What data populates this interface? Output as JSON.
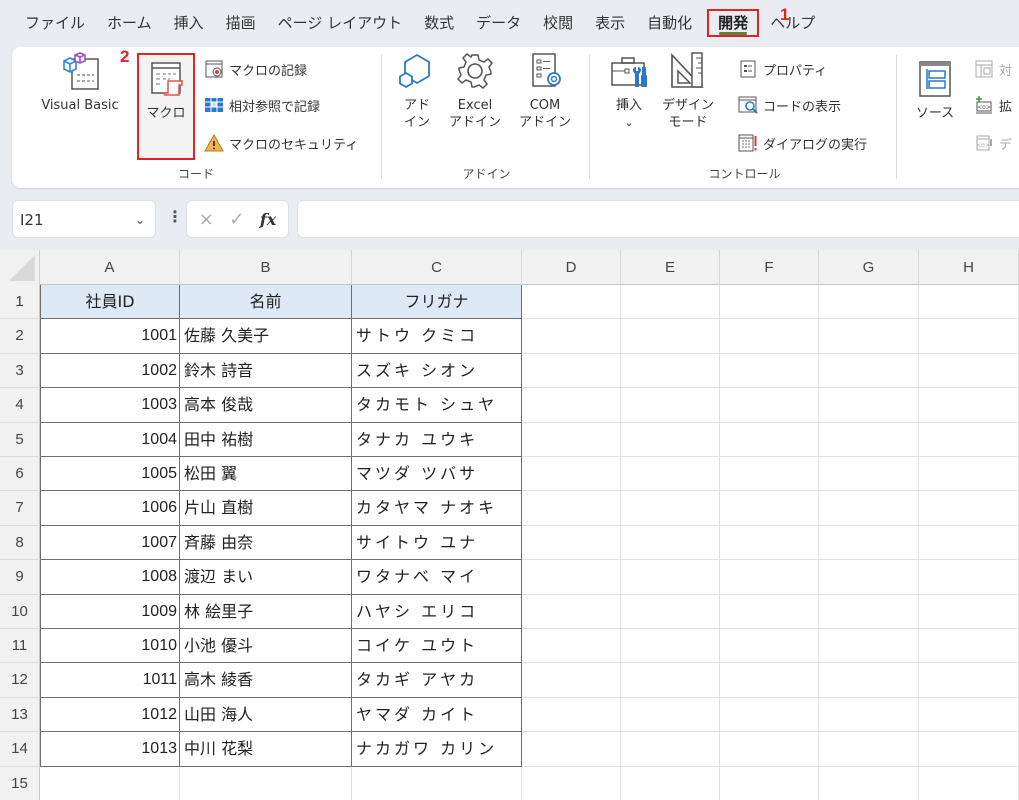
{
  "menu": {
    "tabs": [
      {
        "label": "ファイル"
      },
      {
        "label": "ホーム"
      },
      {
        "label": "挿入"
      },
      {
        "label": "描画"
      },
      {
        "label": "ページ レイアウト"
      },
      {
        "label": "数式"
      },
      {
        "label": "データ"
      },
      {
        "label": "校閲"
      },
      {
        "label": "表示"
      },
      {
        "label": "自動化"
      },
      {
        "label": "開発",
        "active": true
      },
      {
        "label": "ヘルプ"
      }
    ]
  },
  "annotations": {
    "step1": "1",
    "step2": "2",
    "color": "#e02424"
  },
  "ribbon": {
    "groups": {
      "code": {
        "label": "コード",
        "visual_basic": "Visual Basic",
        "macro": "マクロ",
        "record_macro": "マクロの記録",
        "relative_record": "相対参照で記録",
        "macro_security": "マクロのセキュリティ"
      },
      "addins": {
        "label": "アドイン",
        "addin_l1": "アド",
        "addin_l2": "イン",
        "excel_addin_l1": "Excel",
        "excel_addin_l2": "アドイン",
        "com_addin_l1": "COM",
        "com_addin_l2": "アドイン"
      },
      "controls": {
        "label": "コントロール",
        "insert": "挿入",
        "insert_chevron": "⌄",
        "design_mode_l1": "デザイン",
        "design_mode_l2": "モード",
        "properties": "プロパティ",
        "view_code": "コードの表示",
        "run_dialog": "ダイアログの実行"
      },
      "xml": {
        "source": "ソース",
        "map_properties": "対",
        "expansion_packs": "拡",
        "export": "デ"
      }
    }
  },
  "formula_bar": {
    "name_box": "I21",
    "cancel_icon": "×",
    "enter_icon": "✓",
    "fx_label": "fx",
    "formula": ""
  },
  "sheet": {
    "columns": [
      "A",
      "B",
      "C",
      "D",
      "E",
      "F",
      "G",
      "H"
    ],
    "rows": [
      "1",
      "2",
      "3",
      "4",
      "5",
      "6",
      "7",
      "8",
      "9",
      "10",
      "11",
      "12",
      "13",
      "14",
      "15"
    ],
    "table": {
      "headers": [
        "社員ID",
        "名前",
        "フリガナ"
      ],
      "records": [
        {
          "id": "1001",
          "name": "佐藤 久美子",
          "kana": "サトウ クミコ"
        },
        {
          "id": "1002",
          "name": "鈴木 詩音",
          "kana": "スズキ シオン"
        },
        {
          "id": "1003",
          "name": "高本 俊哉",
          "kana": "タカモト シュヤ"
        },
        {
          "id": "1004",
          "name": "田中 祐樹",
          "kana": "タナカ ユウキ"
        },
        {
          "id": "1005",
          "name": "松田 翼",
          "kana": "マツダ ツバサ"
        },
        {
          "id": "1006",
          "name": "片山 直樹",
          "kana": "カタヤマ ナオキ"
        },
        {
          "id": "1007",
          "name": "斉藤 由奈",
          "kana": "サイトウ ユナ"
        },
        {
          "id": "1008",
          "name": "渡辺 まい",
          "kana": "ワタナベ マイ"
        },
        {
          "id": "1009",
          "name": "林 絵里子",
          "kana": "ハヤシ エリコ"
        },
        {
          "id": "1010",
          "name": "小池 優斗",
          "kana": "コイケ ユウト"
        },
        {
          "id": "1011",
          "name": "高木 綾香",
          "kana": "タカギ アヤカ"
        },
        {
          "id": "1012",
          "name": "山田 海人",
          "kana": "ヤマダ カイト"
        },
        {
          "id": "1013",
          "name": "中川 花梨",
          "kana": "ナカガワ カリン"
        }
      ]
    }
  }
}
